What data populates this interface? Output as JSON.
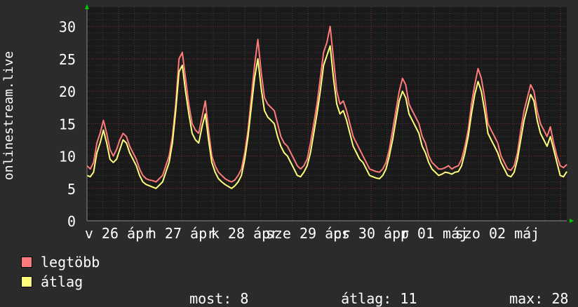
{
  "chart_data": {
    "type": "area",
    "ylabel": "onlinestream.live",
    "ylim": [
      0,
      33
    ],
    "yticks": [
      0,
      5,
      10,
      15,
      20,
      25,
      30
    ],
    "xticks": [
      "v 26 ápr",
      "h 27 ápr",
      "k 28 ápr",
      "sze 29 ápr",
      "cs 30 ápr",
      "p 01 máj",
      "szo 02 máj"
    ],
    "grid": true,
    "legend_position": "bottom-left",
    "series": [
      {
        "name": "legtöbb",
        "color": "#ff7b7b",
        "values": [
          8.5,
          8,
          9,
          12,
          13.5,
          15.5,
          13.5,
          11,
          10,
          11,
          12.5,
          13.5,
          13,
          11.5,
          10.5,
          9.5,
          8,
          7,
          6.5,
          6.3,
          6.2,
          6,
          6.5,
          7,
          8.5,
          10,
          13,
          18,
          25,
          26,
          22,
          18,
          15,
          14,
          13.5,
          16,
          18.5,
          14,
          10,
          8.5,
          7.5,
          7,
          6.5,
          6.2,
          6,
          6.3,
          7,
          8,
          10.5,
          14,
          19,
          24,
          28,
          23,
          19,
          18,
          17.5,
          17,
          15,
          13,
          12,
          11.5,
          10.5,
          9.5,
          8.5,
          8,
          8.5,
          9.5,
          12,
          15,
          18,
          22,
          26,
          27.5,
          30,
          25,
          20,
          18,
          18.5,
          17,
          15,
          13,
          12,
          11,
          10,
          9,
          8,
          7.8,
          7.6,
          7.5,
          8,
          9,
          11,
          14,
          17,
          20,
          22,
          21,
          18,
          17,
          16,
          15,
          13,
          12,
          10,
          9,
          8.5,
          8,
          8,
          8.2,
          8.5,
          8,
          8.3,
          8.5,
          9.5,
          11.5,
          14,
          18,
          21,
          23.5,
          22,
          19,
          15,
          14,
          13,
          12,
          10,
          9,
          8,
          7.8,
          8.5,
          10.5,
          14,
          17,
          19,
          21,
          20,
          17,
          15,
          14,
          13,
          14.5,
          12,
          10,
          8.5,
          8.2,
          8.7
        ]
      },
      {
        "name": "átlag",
        "color": "#ffff7b",
        "values": [
          7,
          6.8,
          7.5,
          10.5,
          12,
          14,
          12,
          9.5,
          9,
          9.5,
          11,
          12.5,
          12,
          10.5,
          9.5,
          8.5,
          7,
          6,
          5.6,
          5.4,
          5.2,
          5,
          5.5,
          6,
          7.5,
          9,
          12,
          17,
          23,
          24,
          20,
          16.5,
          13.5,
          12.5,
          12,
          14.5,
          16.5,
          12.5,
          9,
          7.5,
          6.5,
          6,
          5.6,
          5.3,
          5,
          5.4,
          6,
          7,
          9.5,
          13,
          17.5,
          22,
          25,
          20.5,
          17,
          16,
          15.5,
          15,
          13,
          11.5,
          10.5,
          10,
          9,
          8,
          7,
          6.8,
          7.5,
          8.5,
          10.5,
          13.5,
          16.5,
          20,
          24,
          25.5,
          27,
          22,
          18,
          16.5,
          17,
          15.5,
          13.5,
          11.5,
          10.5,
          9.5,
          9,
          8,
          7,
          6.8,
          6.6,
          6.5,
          7,
          8,
          10,
          12.5,
          15.5,
          18.5,
          20,
          19,
          16.5,
          15.5,
          14.5,
          13.5,
          11.5,
          10.5,
          9,
          8,
          7.5,
          7,
          7.2,
          7.5,
          7.4,
          7.2,
          7.5,
          7.6,
          8.5,
          10.5,
          13,
          16.5,
          19.5,
          21.5,
          20,
          17,
          13.5,
          12.5,
          11.5,
          10.5,
          9,
          8,
          7,
          6.8,
          7.5,
          9.5,
          12.5,
          15.5,
          17.5,
          19.5,
          18.5,
          15.5,
          13.5,
          12.5,
          11.5,
          13,
          11,
          9,
          7,
          6.8,
          7.6
        ]
      }
    ]
  },
  "stats": {
    "most_label": "most:",
    "most_value": "8",
    "atlag_label": "átlag:",
    "atlag_value": "11",
    "max_label": "max:",
    "max_value": "28"
  }
}
